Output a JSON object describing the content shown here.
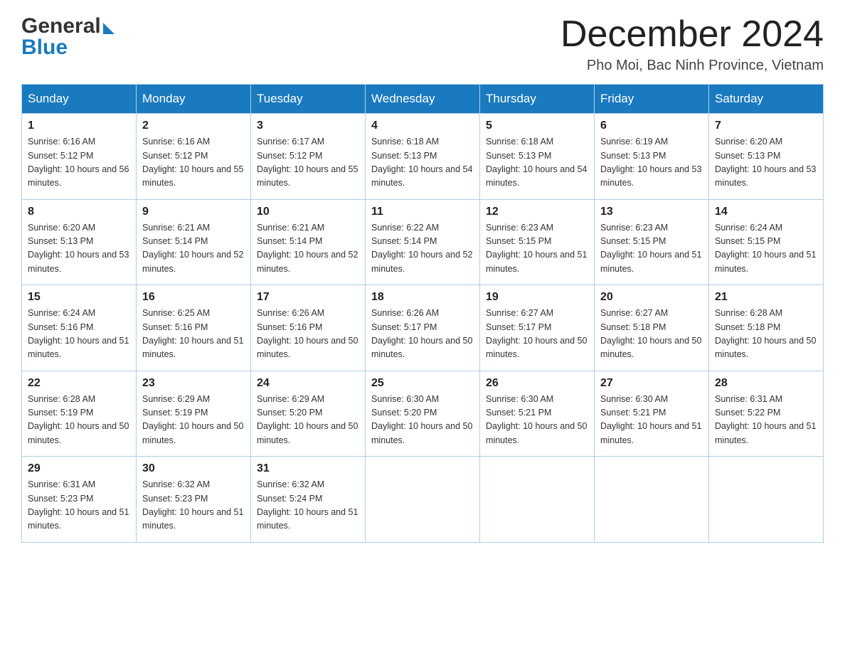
{
  "header": {
    "logo_general": "General",
    "logo_blue": "Blue",
    "title": "December 2024",
    "subtitle": "Pho Moi, Bac Ninh Province, Vietnam"
  },
  "days_of_week": [
    "Sunday",
    "Monday",
    "Tuesday",
    "Wednesday",
    "Thursday",
    "Friday",
    "Saturday"
  ],
  "weeks": [
    [
      {
        "day": "1",
        "sunrise": "Sunrise: 6:16 AM",
        "sunset": "Sunset: 5:12 PM",
        "daylight": "Daylight: 10 hours and 56 minutes."
      },
      {
        "day": "2",
        "sunrise": "Sunrise: 6:16 AM",
        "sunset": "Sunset: 5:12 PM",
        "daylight": "Daylight: 10 hours and 55 minutes."
      },
      {
        "day": "3",
        "sunrise": "Sunrise: 6:17 AM",
        "sunset": "Sunset: 5:12 PM",
        "daylight": "Daylight: 10 hours and 55 minutes."
      },
      {
        "day": "4",
        "sunrise": "Sunrise: 6:18 AM",
        "sunset": "Sunset: 5:13 PM",
        "daylight": "Daylight: 10 hours and 54 minutes."
      },
      {
        "day": "5",
        "sunrise": "Sunrise: 6:18 AM",
        "sunset": "Sunset: 5:13 PM",
        "daylight": "Daylight: 10 hours and 54 minutes."
      },
      {
        "day": "6",
        "sunrise": "Sunrise: 6:19 AM",
        "sunset": "Sunset: 5:13 PM",
        "daylight": "Daylight: 10 hours and 53 minutes."
      },
      {
        "day": "7",
        "sunrise": "Sunrise: 6:20 AM",
        "sunset": "Sunset: 5:13 PM",
        "daylight": "Daylight: 10 hours and 53 minutes."
      }
    ],
    [
      {
        "day": "8",
        "sunrise": "Sunrise: 6:20 AM",
        "sunset": "Sunset: 5:13 PM",
        "daylight": "Daylight: 10 hours and 53 minutes."
      },
      {
        "day": "9",
        "sunrise": "Sunrise: 6:21 AM",
        "sunset": "Sunset: 5:14 PM",
        "daylight": "Daylight: 10 hours and 52 minutes."
      },
      {
        "day": "10",
        "sunrise": "Sunrise: 6:21 AM",
        "sunset": "Sunset: 5:14 PM",
        "daylight": "Daylight: 10 hours and 52 minutes."
      },
      {
        "day": "11",
        "sunrise": "Sunrise: 6:22 AM",
        "sunset": "Sunset: 5:14 PM",
        "daylight": "Daylight: 10 hours and 52 minutes."
      },
      {
        "day": "12",
        "sunrise": "Sunrise: 6:23 AM",
        "sunset": "Sunset: 5:15 PM",
        "daylight": "Daylight: 10 hours and 51 minutes."
      },
      {
        "day": "13",
        "sunrise": "Sunrise: 6:23 AM",
        "sunset": "Sunset: 5:15 PM",
        "daylight": "Daylight: 10 hours and 51 minutes."
      },
      {
        "day": "14",
        "sunrise": "Sunrise: 6:24 AM",
        "sunset": "Sunset: 5:15 PM",
        "daylight": "Daylight: 10 hours and 51 minutes."
      }
    ],
    [
      {
        "day": "15",
        "sunrise": "Sunrise: 6:24 AM",
        "sunset": "Sunset: 5:16 PM",
        "daylight": "Daylight: 10 hours and 51 minutes."
      },
      {
        "day": "16",
        "sunrise": "Sunrise: 6:25 AM",
        "sunset": "Sunset: 5:16 PM",
        "daylight": "Daylight: 10 hours and 51 minutes."
      },
      {
        "day": "17",
        "sunrise": "Sunrise: 6:26 AM",
        "sunset": "Sunset: 5:16 PM",
        "daylight": "Daylight: 10 hours and 50 minutes."
      },
      {
        "day": "18",
        "sunrise": "Sunrise: 6:26 AM",
        "sunset": "Sunset: 5:17 PM",
        "daylight": "Daylight: 10 hours and 50 minutes."
      },
      {
        "day": "19",
        "sunrise": "Sunrise: 6:27 AM",
        "sunset": "Sunset: 5:17 PM",
        "daylight": "Daylight: 10 hours and 50 minutes."
      },
      {
        "day": "20",
        "sunrise": "Sunrise: 6:27 AM",
        "sunset": "Sunset: 5:18 PM",
        "daylight": "Daylight: 10 hours and 50 minutes."
      },
      {
        "day": "21",
        "sunrise": "Sunrise: 6:28 AM",
        "sunset": "Sunset: 5:18 PM",
        "daylight": "Daylight: 10 hours and 50 minutes."
      }
    ],
    [
      {
        "day": "22",
        "sunrise": "Sunrise: 6:28 AM",
        "sunset": "Sunset: 5:19 PM",
        "daylight": "Daylight: 10 hours and 50 minutes."
      },
      {
        "day": "23",
        "sunrise": "Sunrise: 6:29 AM",
        "sunset": "Sunset: 5:19 PM",
        "daylight": "Daylight: 10 hours and 50 minutes."
      },
      {
        "day": "24",
        "sunrise": "Sunrise: 6:29 AM",
        "sunset": "Sunset: 5:20 PM",
        "daylight": "Daylight: 10 hours and 50 minutes."
      },
      {
        "day": "25",
        "sunrise": "Sunrise: 6:30 AM",
        "sunset": "Sunset: 5:20 PM",
        "daylight": "Daylight: 10 hours and 50 minutes."
      },
      {
        "day": "26",
        "sunrise": "Sunrise: 6:30 AM",
        "sunset": "Sunset: 5:21 PM",
        "daylight": "Daylight: 10 hours and 50 minutes."
      },
      {
        "day": "27",
        "sunrise": "Sunrise: 6:30 AM",
        "sunset": "Sunset: 5:21 PM",
        "daylight": "Daylight: 10 hours and 51 minutes."
      },
      {
        "day": "28",
        "sunrise": "Sunrise: 6:31 AM",
        "sunset": "Sunset: 5:22 PM",
        "daylight": "Daylight: 10 hours and 51 minutes."
      }
    ],
    [
      {
        "day": "29",
        "sunrise": "Sunrise: 6:31 AM",
        "sunset": "Sunset: 5:23 PM",
        "daylight": "Daylight: 10 hours and 51 minutes."
      },
      {
        "day": "30",
        "sunrise": "Sunrise: 6:32 AM",
        "sunset": "Sunset: 5:23 PM",
        "daylight": "Daylight: 10 hours and 51 minutes."
      },
      {
        "day": "31",
        "sunrise": "Sunrise: 6:32 AM",
        "sunset": "Sunset: 5:24 PM",
        "daylight": "Daylight: 10 hours and 51 minutes."
      },
      null,
      null,
      null,
      null
    ]
  ]
}
